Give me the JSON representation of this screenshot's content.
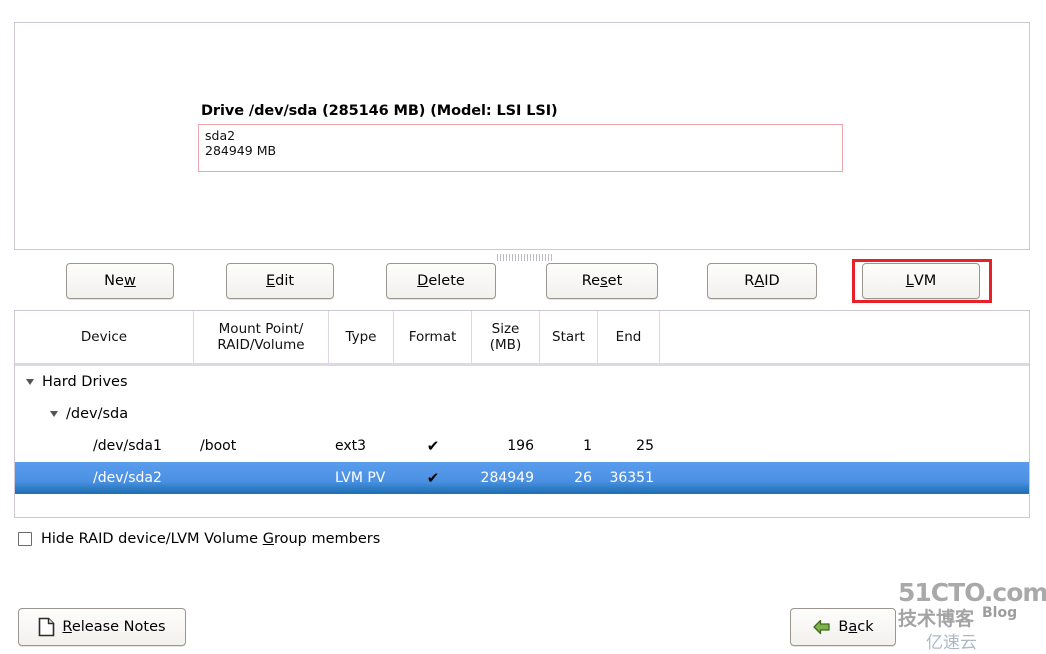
{
  "drive_preview": {
    "title": "Drive /dev/sda (285146 MB) (Model: LSI LSI)",
    "partition_name": "sda2",
    "partition_size": "284949 MB"
  },
  "toolbar": {
    "new_label": "Ne",
    "new_acc": "w",
    "edit_acc": "E",
    "edit_label": "dit",
    "delete_acc": "D",
    "delete_label": "elete",
    "reset_pre": "Re",
    "reset_acc": "s",
    "reset_post": "et",
    "raid_pre": "R",
    "raid_acc": "A",
    "raid_post": "ID",
    "lvm_acc": "L",
    "lvm_post": "VM"
  },
  "table": {
    "headers": {
      "device": "Device",
      "mount_line1": "Mount Point/",
      "mount_line2": "RAID/Volume",
      "type": "Type",
      "format": "Format",
      "size_line1": "Size",
      "size_line2": "(MB)",
      "start": "Start",
      "end": "End"
    },
    "rows": [
      {
        "device": "Hard Drives",
        "mount": "",
        "type": "",
        "format": "",
        "size": "",
        "start": "",
        "end": ""
      },
      {
        "device": "/dev/sda",
        "mount": "",
        "type": "",
        "format": "",
        "size": "",
        "start": "",
        "end": ""
      },
      {
        "device": "/dev/sda1",
        "mount": "/boot",
        "type": "ext3",
        "format": "✔",
        "size": "196",
        "start": "1",
        "end": "25"
      },
      {
        "device": "/dev/sda2",
        "mount": "",
        "type": "LVM PV",
        "format": "✔",
        "size": "284949",
        "start": "26",
        "end": "36351"
      }
    ]
  },
  "options": {
    "hide_pre": "Hide RAID device/LVM Volume ",
    "hide_acc": "G",
    "hide_post": "roup members",
    "hide_checked": false
  },
  "footer": {
    "release_acc": "R",
    "release_post": "elease Notes",
    "back_pre": "B",
    "back_acc": "a",
    "back_post": "ck"
  },
  "watermark": {
    "top": "51CTO.com",
    "mid": "技术博客",
    "blog": "Blog",
    "bottom": "亿速云"
  },
  "colors": {
    "selection_blue": "#4a90e2",
    "highlight_red": "#e8202a",
    "panel_border": "#cfc8d4",
    "bar_border": "#eca6ab"
  }
}
